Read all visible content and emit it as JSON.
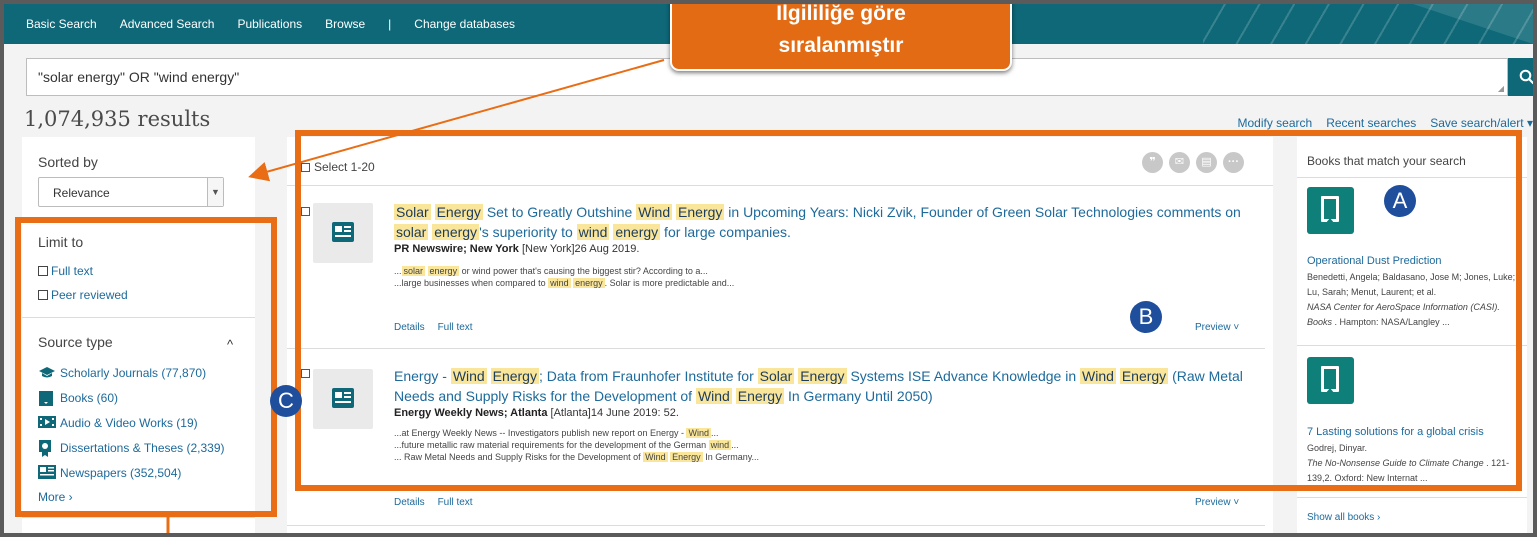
{
  "nav": {
    "items": [
      "Basic Search",
      "Advanced Search",
      "Publications",
      "Browse",
      "|",
      "Change databases"
    ]
  },
  "search": {
    "query": "\"solar energy\" OR \"wind energy\""
  },
  "results_count": "1,074,935 results",
  "top_links": [
    "Modify search",
    "Recent searches",
    "Save search/alert ▾"
  ],
  "sidebar": {
    "sorted_by_label": "Sorted by",
    "sort_value": "Relevance",
    "limit_to_label": "Limit to",
    "limit_options": [
      "Full text",
      "Peer reviewed"
    ],
    "source_type_label": "Source type",
    "source_types": [
      {
        "label": "Scholarly Journals (77,870)",
        "icon": "graduation-cap-icon"
      },
      {
        "label": "Books (60)",
        "icon": "book-icon"
      },
      {
        "label": "Audio & Video Works (19)",
        "icon": "video-icon"
      },
      {
        "label": "Dissertations & Theses (2,339)",
        "icon": "certificate-icon"
      },
      {
        "label": "Newspapers (352,504)",
        "icon": "newspaper-icon"
      }
    ],
    "more_label": "More ›"
  },
  "main": {
    "select_label": "Select 1-20",
    "tool_icons": [
      "quote-icon",
      "email-icon",
      "print-icon",
      "more-icon"
    ],
    "results": [
      {
        "title_parts": [
          {
            "t": "Solar",
            "hl": true
          },
          {
            "t": " ",
            "hl": false
          },
          {
            "t": "Energy",
            "hl": true
          },
          {
            "t": " Set to Greatly Outshine ",
            "hl": false
          },
          {
            "t": "Wind",
            "hl": true
          },
          {
            "t": " ",
            "hl": false
          },
          {
            "t": "Energy",
            "hl": true
          },
          {
            "t": " in Upcoming Years: Nicki Zvik, Founder of Green Solar Technologies comments on ",
            "hl": false
          },
          {
            "t": "solar",
            "hl": true
          },
          {
            "t": " ",
            "hl": false
          },
          {
            "t": "energy",
            "hl": true
          },
          {
            "t": "'s superiority to ",
            "hl": false
          },
          {
            "t": "wind",
            "hl": true
          },
          {
            "t": " ",
            "hl": false
          },
          {
            "t": "energy",
            "hl": true
          },
          {
            "t": " for large companies.",
            "hl": false
          }
        ],
        "source_bold": "PR Newswire; New York",
        "source_rest": " [New York]26 Aug 2019.",
        "snippets": [
          [
            {
              "t": "...",
              "hl": false
            },
            {
              "t": "solar",
              "hl": true
            },
            {
              "t": " ",
              "hl": false
            },
            {
              "t": "energy",
              "hl": true
            },
            {
              "t": " or wind power that's causing the biggest stir? According to a...",
              "hl": false
            }
          ],
          [
            {
              "t": "...large businesses when compared to ",
              "hl": false
            },
            {
              "t": "wind",
              "hl": true
            },
            {
              "t": " ",
              "hl": false
            },
            {
              "t": "energy",
              "hl": true
            },
            {
              "t": ". Solar is more predictable and...",
              "hl": false
            }
          ]
        ],
        "links": [
          "Details",
          "Full text"
        ],
        "preview": "Preview ˅"
      },
      {
        "title_parts": [
          {
            "t": "Energy - ",
            "hl": false
          },
          {
            "t": "Wind",
            "hl": true
          },
          {
            "t": " ",
            "hl": false
          },
          {
            "t": "Energy",
            "hl": true
          },
          {
            "t": "; Data from Fraunhofer Institute for ",
            "hl": false
          },
          {
            "t": "Solar",
            "hl": true
          },
          {
            "t": " ",
            "hl": false
          },
          {
            "t": "Energy",
            "hl": true
          },
          {
            "t": " Systems ISE Advance Knowledge in ",
            "hl": false
          },
          {
            "t": "Wind",
            "hl": true
          },
          {
            "t": " ",
            "hl": false
          },
          {
            "t": "Energy",
            "hl": true
          },
          {
            "t": " (Raw Metal Needs and Supply Risks for the Development of ",
            "hl": false
          },
          {
            "t": "Wind",
            "hl": true
          },
          {
            "t": " ",
            "hl": false
          },
          {
            "t": "Energy",
            "hl": true
          },
          {
            "t": " In Germany Until 2050)",
            "hl": false
          }
        ],
        "source_bold": "Energy Weekly News; Atlanta",
        "source_rest": " [Atlanta]14 June 2019: 52.",
        "snippets": [
          [
            {
              "t": "...at Energy Weekly News -- Investigators publish new report on Energy - ",
              "hl": false
            },
            {
              "t": "Wind",
              "hl": true
            },
            {
              "t": "...",
              "hl": false
            }
          ],
          [
            {
              "t": "...future metallic raw material requirements for the development of the German ",
              "hl": false
            },
            {
              "t": "wind",
              "hl": true
            },
            {
              "t": "...",
              "hl": false
            }
          ],
          [
            {
              "t": "... Raw Metal Needs and Supply Risks for the Development of ",
              "hl": false
            },
            {
              "t": "Wind",
              "hl": true
            },
            {
              "t": " ",
              "hl": false
            },
            {
              "t": "Energy",
              "hl": true
            },
            {
              "t": " In Germany...",
              "hl": false
            }
          ]
        ],
        "links": [
          "Details",
          "Full text"
        ],
        "preview": "Preview ˅"
      }
    ]
  },
  "books": {
    "title": "Books that match your search",
    "items": [
      {
        "title": "Operational Dust Prediction",
        "authors": "Benedetti, Angela; Baldasano, Jose M; Jones, Luke; Lu, Sarah; Menut, Laurent; et al.",
        "pub_italic": "NASA Center for AeroSpace Information (CASI). Books",
        "pub_rest": " . Hampton: NASA/Langley ..."
      },
      {
        "title": "7 Lasting solutions for a global crisis",
        "authors": "Godrej, Dinyar.",
        "pub_italic": "The No-Nonsense Guide to Climate Change",
        "pub_rest": " . 121-139,2. Oxford: New Internat ..."
      }
    ],
    "show_all": "Show all books ›"
  },
  "annotations": {
    "callout_line1": "İlgililiğe göre",
    "callout_line2": "sıralanmıştır",
    "badge_a": "A",
    "badge_b": "B",
    "badge_c": "C",
    "accent": "#e86d14",
    "badge_color": "#1f4e9c"
  },
  "colors": {
    "nav_bg": "#0e6878",
    "link": "#1d6a9b",
    "highlight": "#fae69a",
    "book_icon": "#0f7f79"
  }
}
